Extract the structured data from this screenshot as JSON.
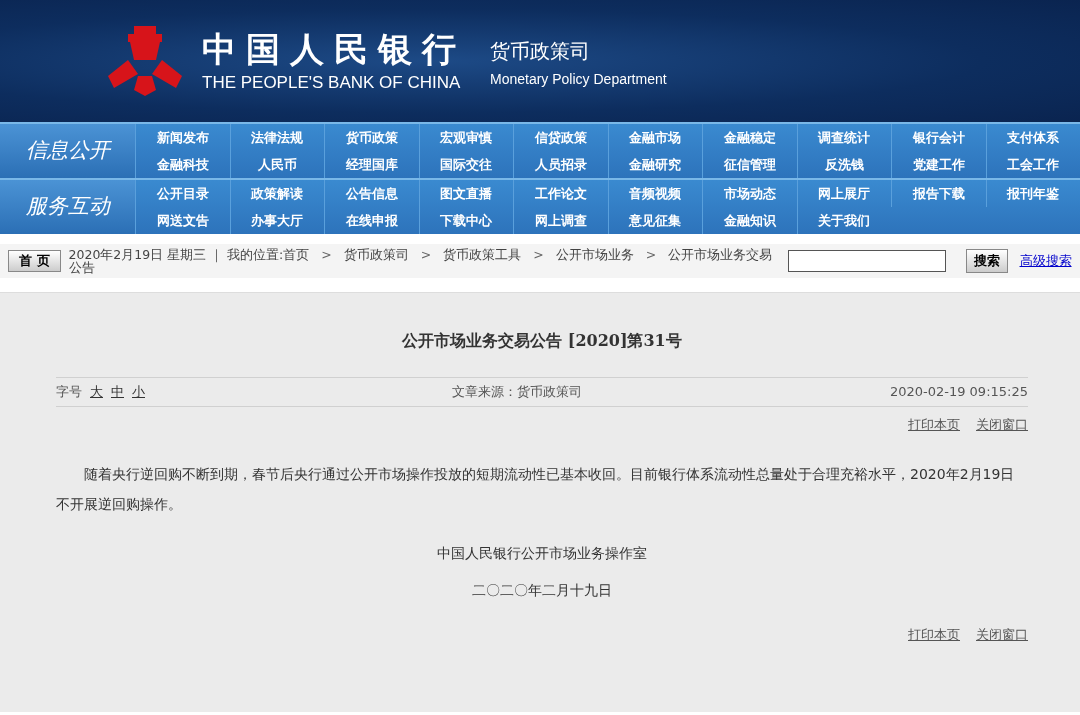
{
  "header": {
    "bank_name_cn": "中国人民银行",
    "bank_name_en": "THE PEOPLE'S BANK OF CHINA",
    "dept_cn": "货币政策司",
    "dept_en": "Monetary Policy Department"
  },
  "nav_sections": [
    {
      "label": "信息公开",
      "links": [
        "新闻发布",
        "法律法规",
        "货币政策",
        "宏观审慎",
        "信贷政策",
        "金融市场",
        "金融稳定",
        "调查统计",
        "银行会计",
        "支付体系",
        "金融科技",
        "人民币",
        "经理国库",
        "国际交往",
        "人员招录",
        "金融研究",
        "征信管理",
        "反洗钱",
        "党建工作",
        "工会工作"
      ]
    },
    {
      "label": "服务互动",
      "links": [
        "公开目录",
        "政策解读",
        "公告信息",
        "图文直播",
        "工作论文",
        "音频视频",
        "市场动态",
        "网上展厅",
        "报告下载",
        "报刊年鉴",
        "网送文告",
        "办事大厅",
        "在线申报",
        "下载中心",
        "网上调查",
        "意见征集",
        "金融知识",
        "关于我们"
      ]
    }
  ],
  "toolbar": {
    "home_button": "首 页",
    "date": "2020年2月19日 星期三 ｜ 我的位置:",
    "separator": ">",
    "crumbs": [
      "首页",
      "货币政策司",
      "货币政策工具",
      "公开市场业务",
      "公开市场业务交易公告"
    ],
    "search_button": "搜索",
    "advanced_search": "高级搜索"
  },
  "article": {
    "title": "公开市场业务交易公告 [2020]第31号",
    "font_size_label": "字号",
    "font_sizes": [
      "大",
      "中",
      "小"
    ],
    "source": "文章来源：货币政策司",
    "datetime": "2020-02-19 09:15:25",
    "actions_top": [
      "打印本页",
      "关闭窗口"
    ],
    "body": "随着央行逆回购不断到期，春节后央行通过公开市场操作投放的短期流动性已基本收回。目前银行体系流动性总量处于合理充裕水平，2020年2月19日不开展逆回购操作。",
    "signature": "中国人民银行公开市场业务操作室",
    "date_cn": "二〇二〇年二月十九日",
    "actions_bottom": [
      "打印本页",
      "关闭窗口"
    ]
  }
}
